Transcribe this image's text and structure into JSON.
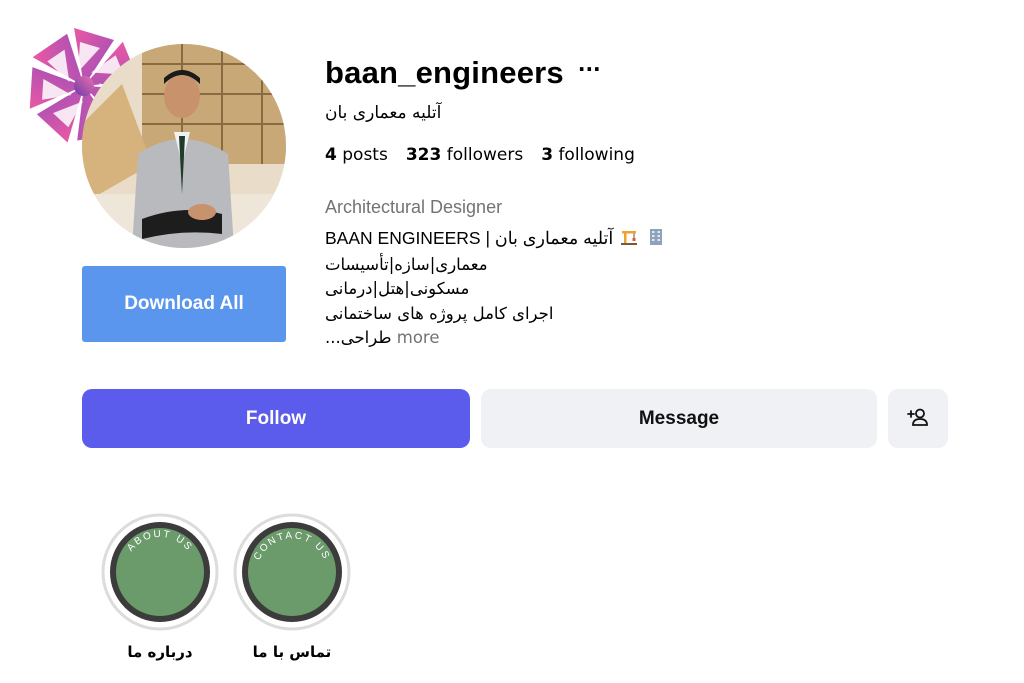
{
  "profile": {
    "username": "baan_engineers",
    "full_name": "آتلیه معماری بان",
    "category": "Architectural Designer",
    "stats": {
      "posts_count": "4",
      "posts_label": "posts",
      "followers_count": "323",
      "followers_label": "followers",
      "following_count": "3",
      "following_label": "following"
    },
    "bio": {
      "line1_text": "BAAN ENGINEERS | آتلیه معماری بان",
      "line1_emojis": [
        "construction-crane-icon",
        "office-building-icon"
      ],
      "line2": "معماری|سازه|تأسیسات",
      "line3": "مسکونی|هتل|درمانی",
      "line4": "اجرای کامل پروژه های ساختمانی",
      "line5": "طراحی...",
      "more_label": "more"
    }
  },
  "actions": {
    "download_all_label": "Download All",
    "follow_label": "Follow",
    "message_label": "Message",
    "add_user_icon": "add-person-icon",
    "options_label": "···"
  },
  "highlights": [
    {
      "ring_text": "ABOUT US",
      "label": "درباره ما"
    },
    {
      "ring_text": "CONTACT US",
      "label": "تماس با ما"
    }
  ],
  "colors": {
    "download_button": "#5b96ee",
    "follow_button": "#5b5ceb",
    "secondary_button": "#eff1f5",
    "highlight_fill": "#6b9a6b",
    "muted_text": "#737373"
  }
}
